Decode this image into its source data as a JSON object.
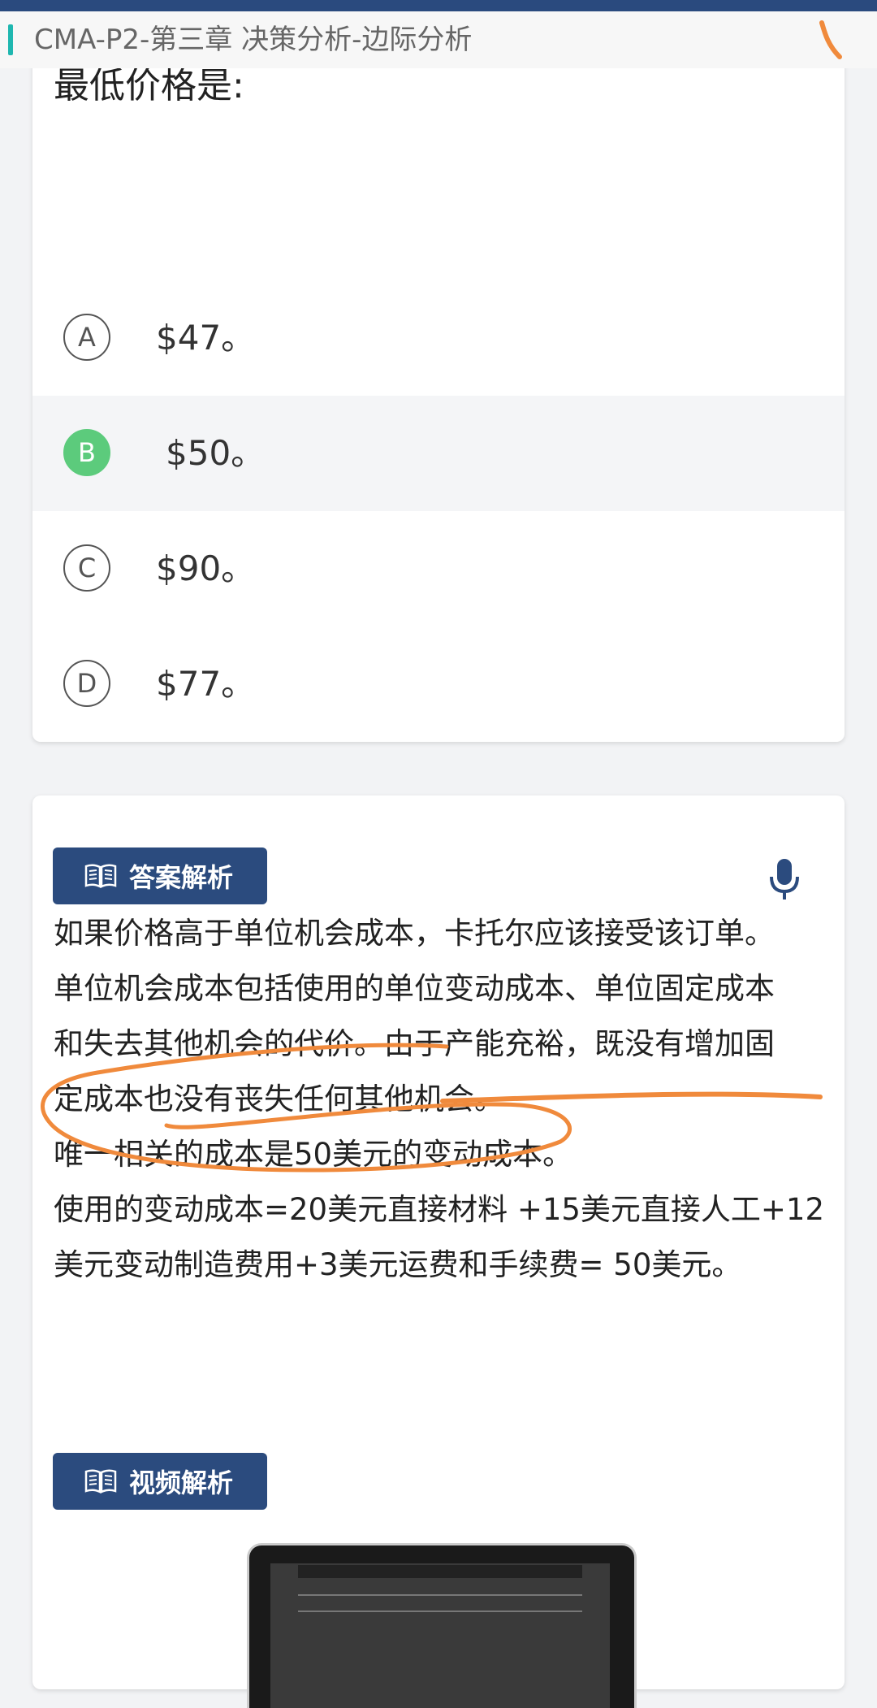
{
  "header": {
    "title": "CMA-P2-第三章  决策分析-边际分析"
  },
  "question": {
    "text": "最低价格是:",
    "options": [
      {
        "letter": "A",
        "text": "$47。",
        "selected": false
      },
      {
        "letter": "B",
        "text": "$50。",
        "selected": true
      },
      {
        "letter": "C",
        "text": "$90。",
        "selected": false
      },
      {
        "letter": "D",
        "text": "$77。",
        "selected": false
      }
    ]
  },
  "answer": {
    "badge_label": "答案解析",
    "lines": [
      "如果价格高于单位机会成本，卡托尔应该接受该订单。",
      "单位机会成本包括使用的单位变动成本、单位固定成本",
      "和失去其他机会的代价。由于产能充裕，既没有增加固",
      "定成本也没有丧失任何其他机会。",
      "唯一相关的成本是50美元的变动成本。",
      "使用的变动成本=20美元直接材料 +15美元直接人工+12",
      "美元变动制造费用+3美元运费和手续费= 50美元。"
    ]
  },
  "video": {
    "badge_label": "视频解析"
  },
  "icons": {
    "badge_icon": "open-book-icon",
    "mic_icon": "microphone-icon"
  },
  "colors": {
    "accent": "#1fb7b0",
    "badge": "#2b4b7e",
    "selected": "#5ccb7c",
    "annotation": "#f08a3c"
  }
}
